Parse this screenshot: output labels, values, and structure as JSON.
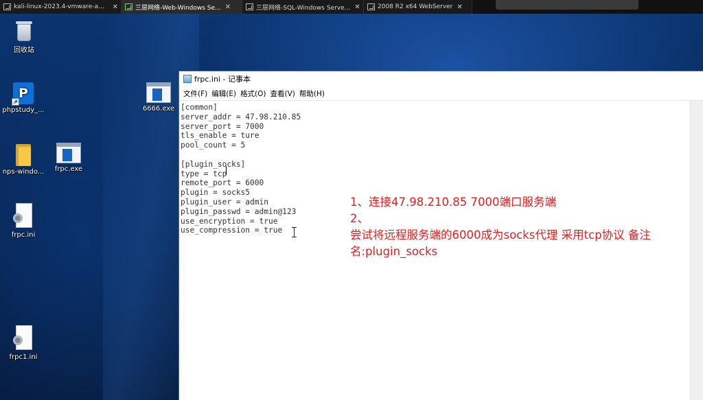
{
  "tabs": [
    {
      "label": "kali-linux-2023.4-vmware-am...",
      "active": false
    },
    {
      "label": "三层网络-Web-Windows Se...",
      "active": true
    },
    {
      "label": "三层网络-SQL-Windows Serve...",
      "active": false
    },
    {
      "label": "2008 R2 x64 WebServer",
      "active": false
    }
  ],
  "desktop_icons": {
    "recycle_bin": "回收站",
    "phpstudy": "phpstudy_...",
    "exe_6666": "6666.exe",
    "nps_folder": "nps-windo...",
    "frpc_exe": "frpc.exe",
    "frpc_ini": "frpc.ini",
    "frpc1_ini": "frpc1.ini"
  },
  "notepad": {
    "title": "frpc.ini - 记事本",
    "menu": [
      "文件(F)",
      "编辑(E)",
      "格式(O)",
      "查看(V)",
      "帮助(H)"
    ],
    "content": "[common]\nserver_addr = 47.98.210.85\nserver_port = 7000\ntls_enable = ture\npool_count = 5\n\n[plugin_socks]\ntype = tcp\nremote_port = 6000\nplugin = socks5\nplugin_user = admin\nplugin_passwd = admin@123\nuse_encryption = true\nuse_compression = true"
  },
  "annotation": {
    "line1": "1、连接47.98.210.85 7000端口服务端",
    "line2": "2、",
    "line3": "尝试将远程服务端的6000成为socks代理 采用tcp协议 备注名:plugin_socks",
    "color": "#e02020"
  }
}
